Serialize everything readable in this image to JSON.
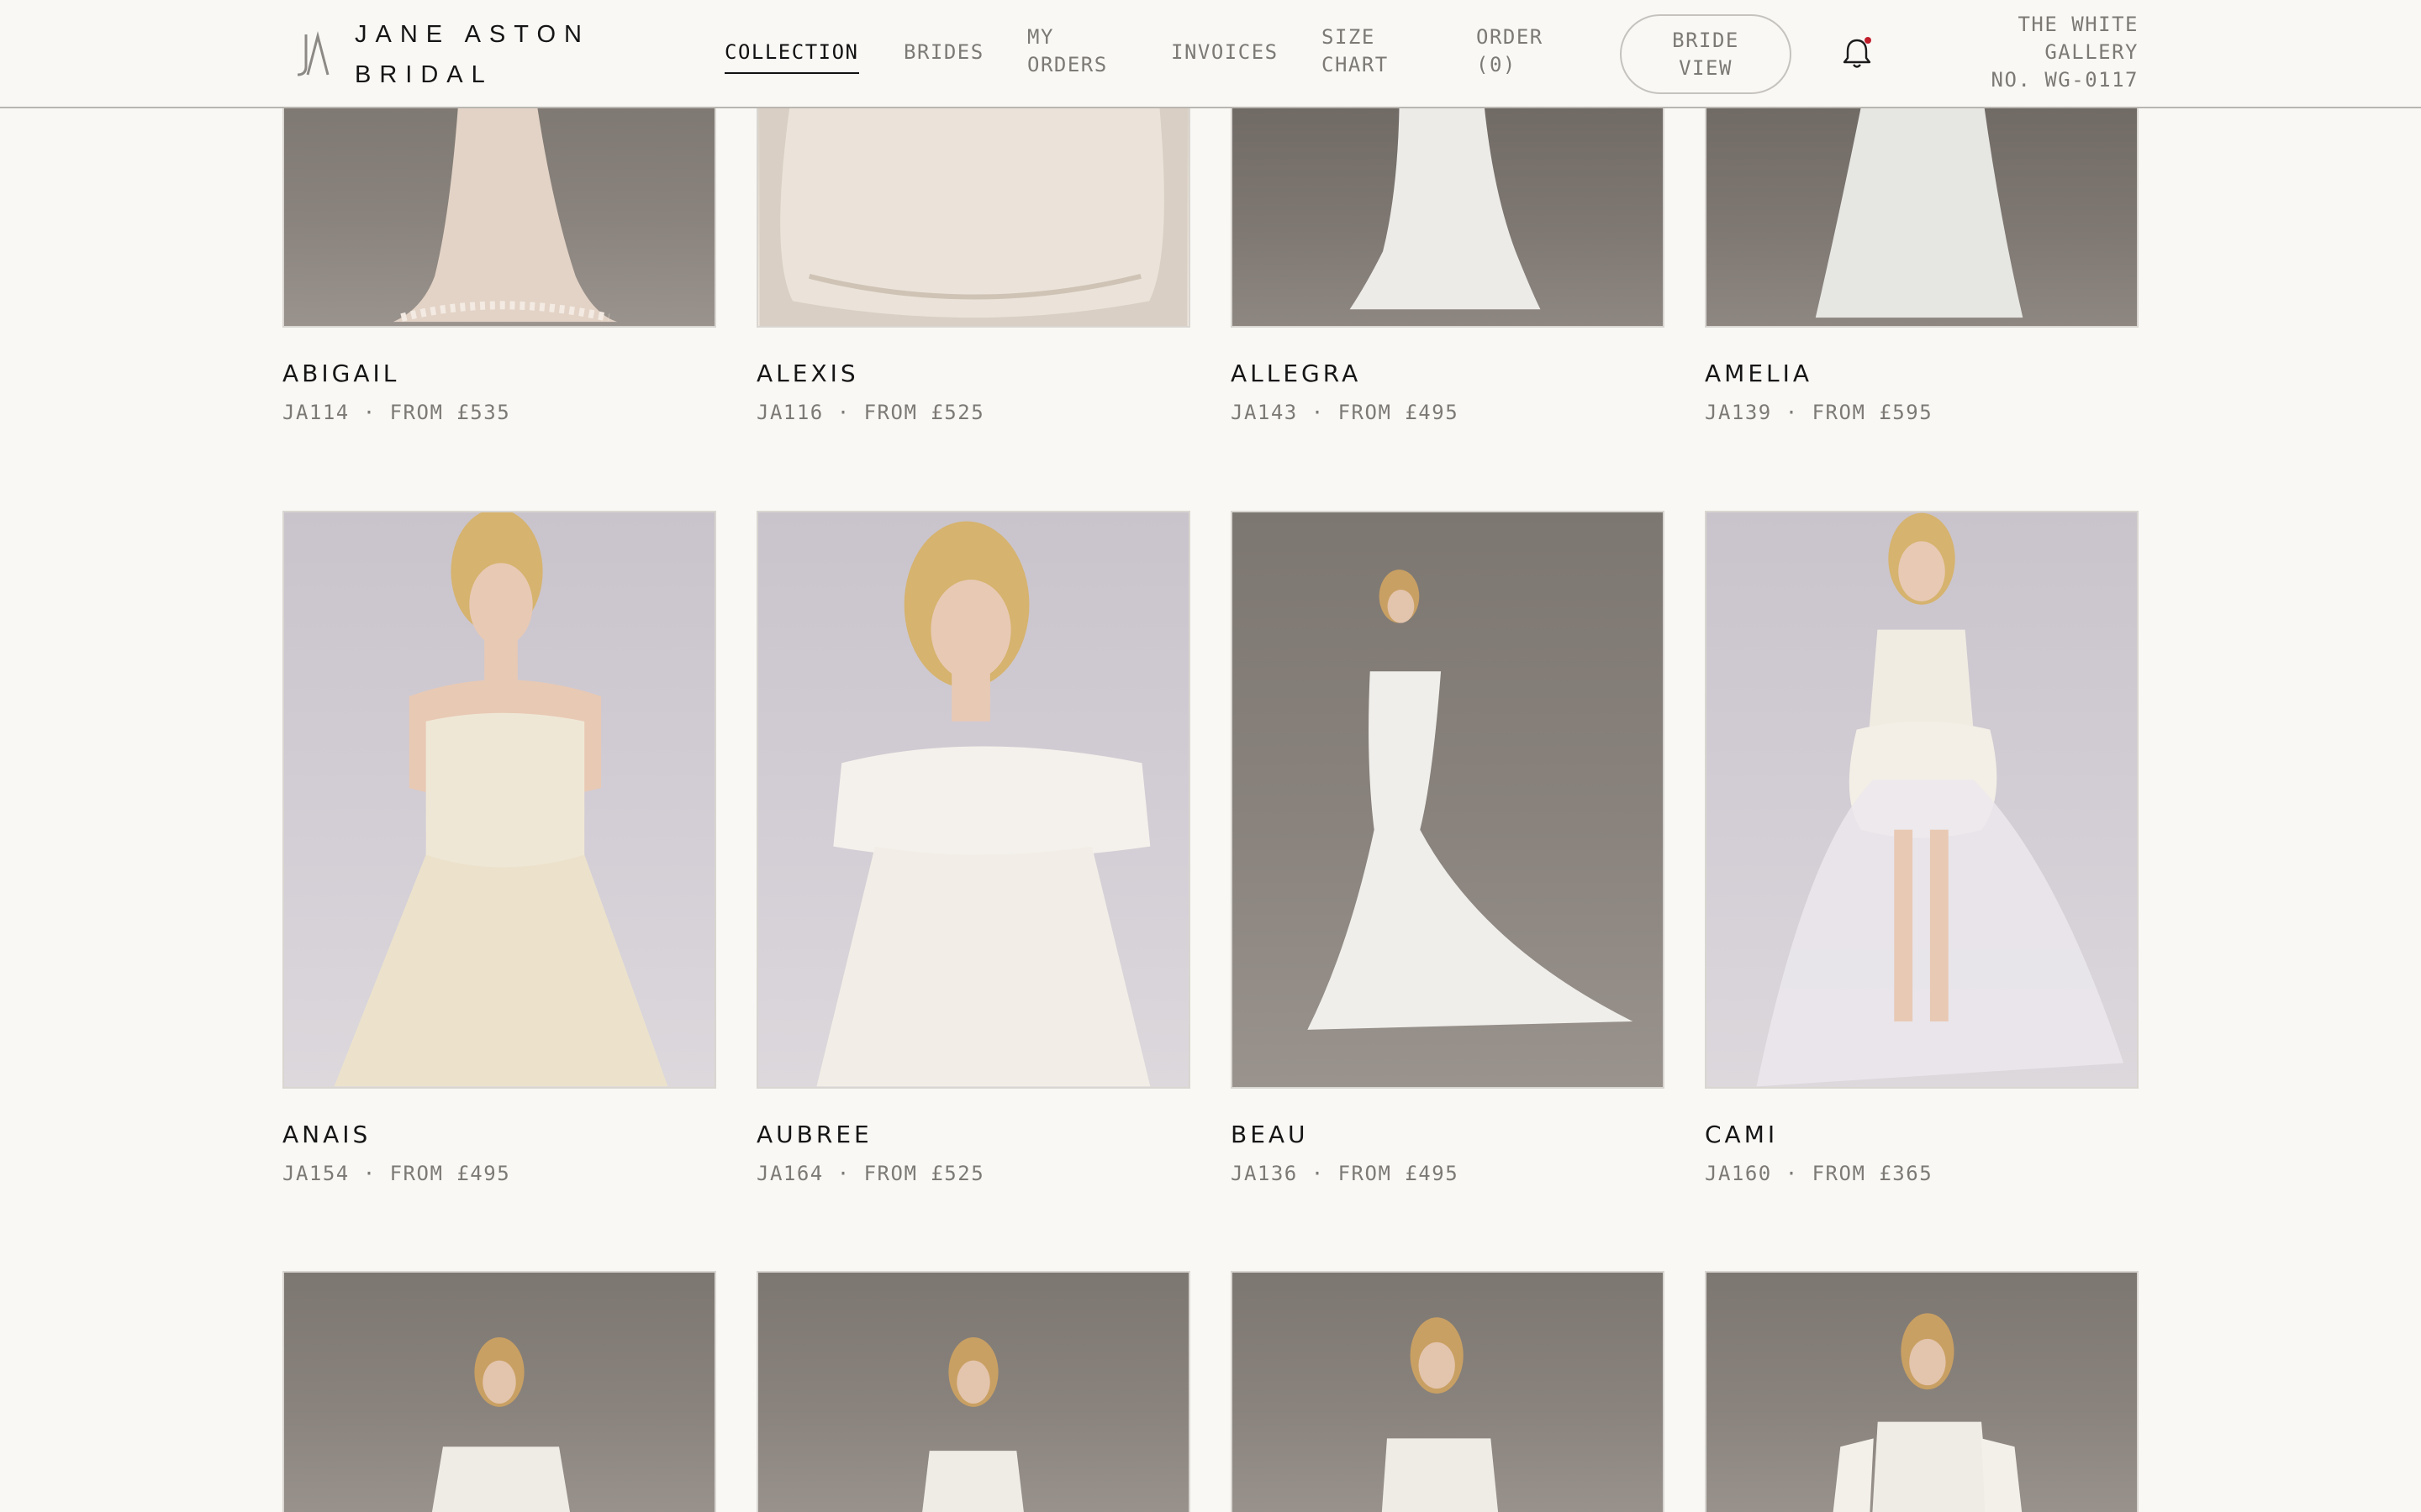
{
  "brand": {
    "line1": "JANE ASTON",
    "line2": "BRIDAL",
    "mark_icon": "ja-monogram-icon"
  },
  "nav": {
    "collection": "COLLECTION",
    "brides": "BRIDES",
    "my_orders_1": "MY",
    "my_orders_2": "ORDERS",
    "invoices": "INVOICES",
    "size_chart_1": "SIZE",
    "size_chart_2": "CHART",
    "order_1": "ORDER",
    "order_2": "(0)",
    "active": "COLLECTION"
  },
  "bride_view": {
    "line1": "BRIDE",
    "line2": "VIEW"
  },
  "notifications": {
    "icon": "bell-icon",
    "dot_color": "#c21f2d"
  },
  "gallery": {
    "line1": "THE WHITE",
    "line2": "GALLERY",
    "line3": "NO. WG-0117"
  },
  "products": [
    {
      "name": "ABIGAIL",
      "meta": "JA114 · FROM £535"
    },
    {
      "name": "ALEXIS",
      "meta": "JA116 · FROM £525"
    },
    {
      "name": "ALLEGRA",
      "meta": "JA143 · FROM £495"
    },
    {
      "name": "AMELIA",
      "meta": "JA139 · FROM £595"
    },
    {
      "name": "ANAIS",
      "meta": "JA154 · FROM £495"
    },
    {
      "name": "AUBREE",
      "meta": "JA164 · FROM £525"
    },
    {
      "name": "BEAU",
      "meta": "JA136 · FROM £495"
    },
    {
      "name": "CAMI",
      "meta": "JA160 · FROM £365"
    }
  ],
  "colors": {
    "background": "#f9f8f5",
    "accent_text": "#111111",
    "muted_text": "#7d7a75"
  }
}
